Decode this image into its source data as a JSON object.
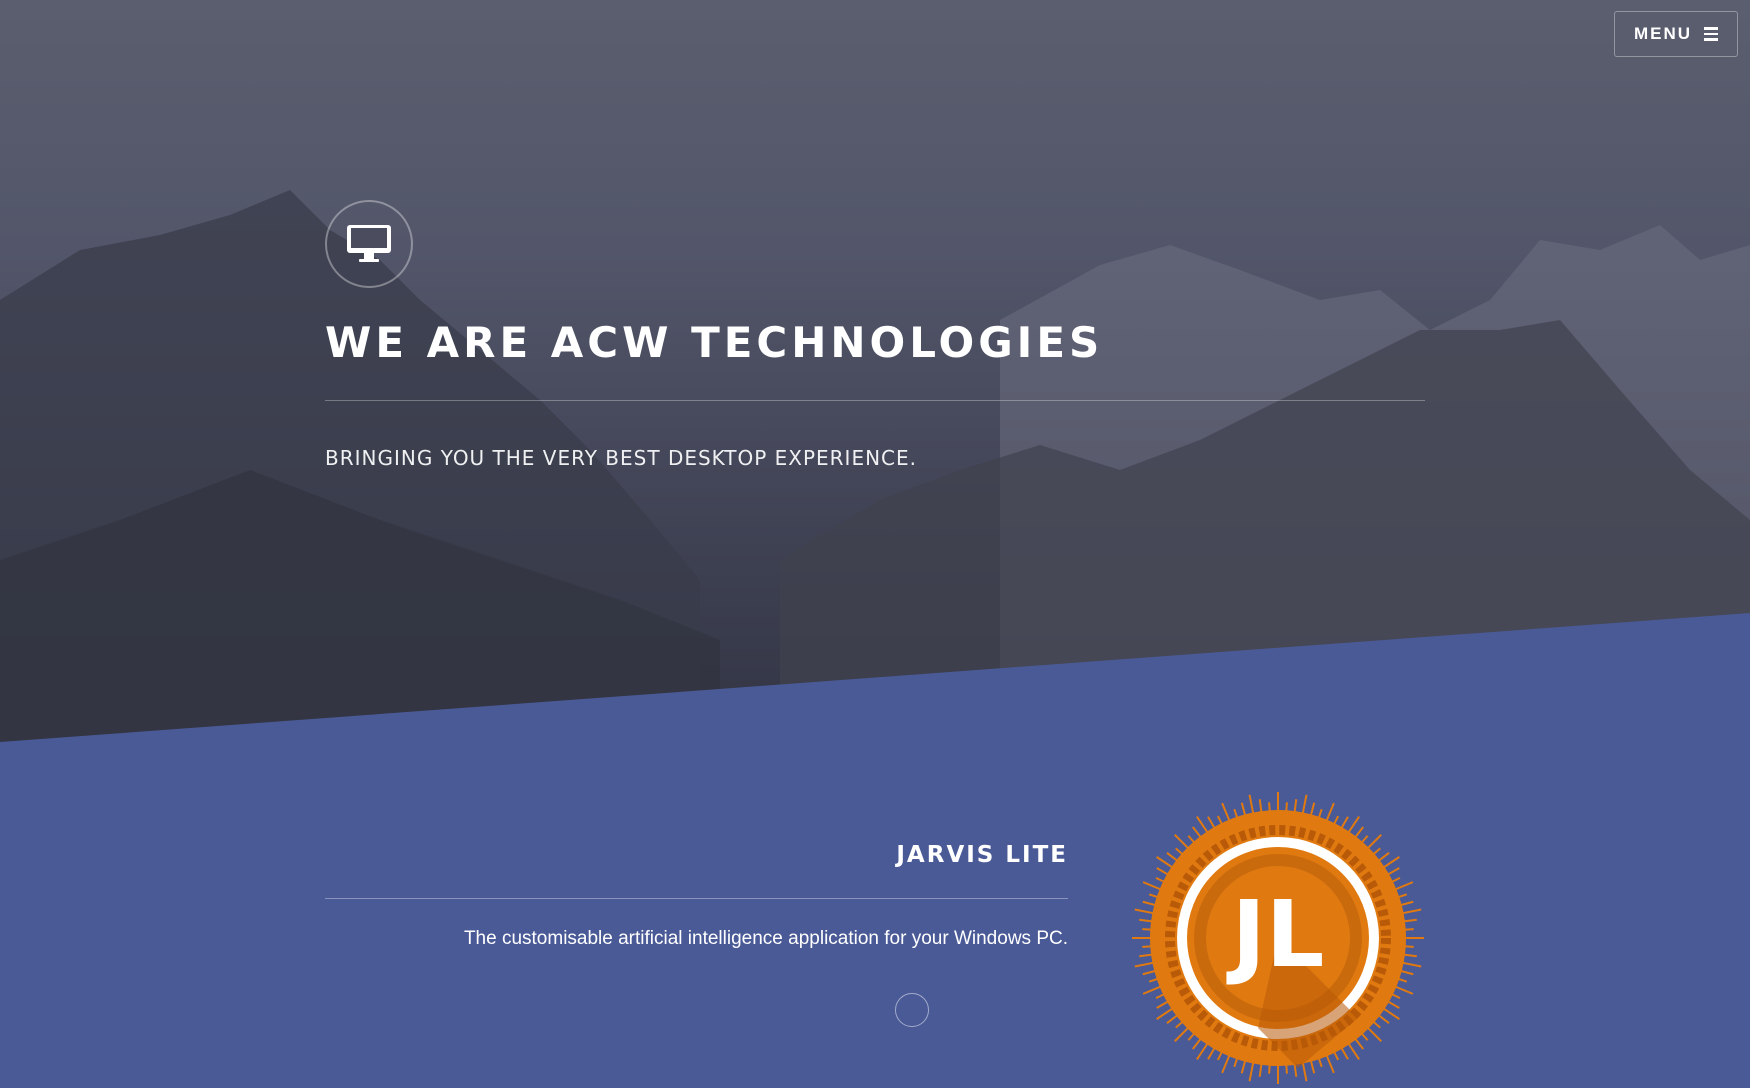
{
  "header": {
    "menu_label": "MENU",
    "menu_icon": "hamburger-icon"
  },
  "hero": {
    "icon": "desktop-monitor-icon",
    "title": "WE ARE ACW TECHNOLOGIES",
    "subtitle": "BRINGING YOU THE VERY BEST DESKTOP EXPERIENCE."
  },
  "product": {
    "title": "JARVIS LITE",
    "description": "The customisable artificial intelligence application for your Windows PC.",
    "logo_text": "JL"
  },
  "colors": {
    "section_blue": "#4a5a97",
    "logo_orange": "#e07a10",
    "logo_dark_orange": "#b85a08"
  }
}
